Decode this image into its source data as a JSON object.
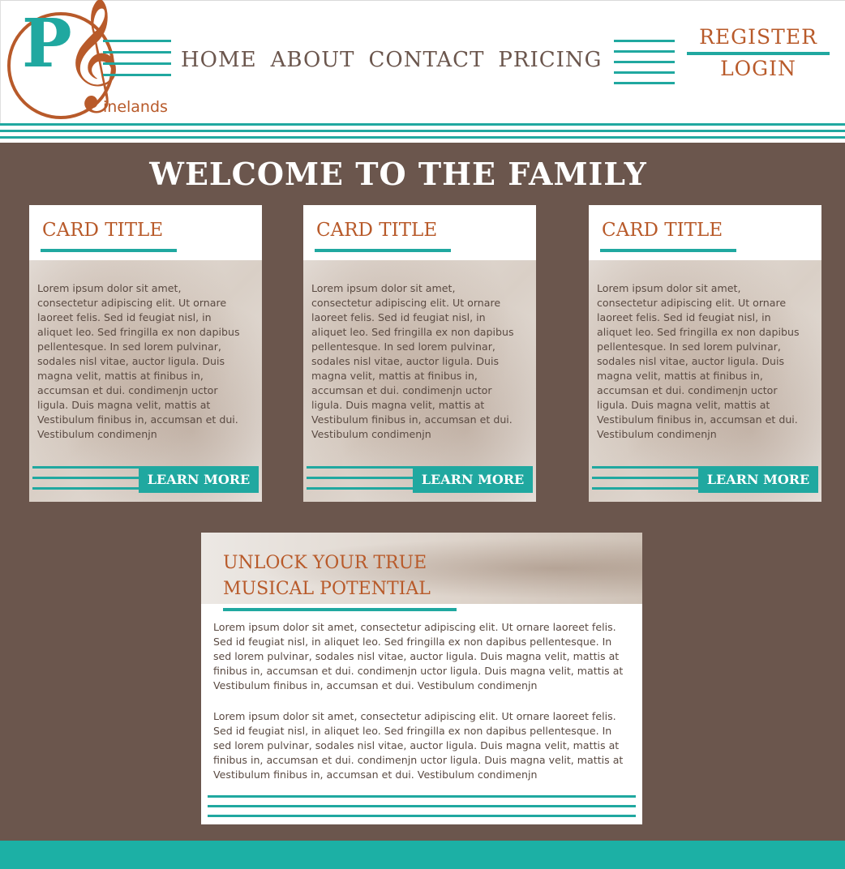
{
  "brand": {
    "logo_letter": "P",
    "logo_symbol": "𝄞",
    "logo_text": "inelands"
  },
  "nav": {
    "items": [
      {
        "label": "HOME"
      },
      {
        "label": "ABOUT"
      },
      {
        "label": "CONTACT"
      },
      {
        "label": "PRICING"
      }
    ]
  },
  "auth": {
    "register": "REGISTER",
    "login": "LOGIN"
  },
  "main": {
    "heading": "WELCOME TO THE FAMILY",
    "cards": [
      {
        "title": "CARD TITLE",
        "body": "Lorem ipsum dolor sit amet, consectetur adipiscing elit. Ut ornare laoreet felis. Sed id feugiat nisl, in aliquet leo. Sed fringilla ex non dapibus pellentesque. In sed lorem pulvinar, sodales nisl vitae, auctor ligula. Duis magna velit, mattis at finibus in, accumsan et dui. condimenjn uctor ligula. Duis magna velit, mattis at Vestibulum finibus in, accumsan et dui. Vestibulum condimenjn",
        "button": "LEARN MORE"
      },
      {
        "title": "CARD TITLE",
        "body": "Lorem ipsum dolor sit amet, consectetur adipiscing elit. Ut ornare laoreet felis. Sed id feugiat nisl, in aliquet leo. Sed fringilla ex non dapibus pellentesque. In sed lorem pulvinar, sodales nisl vitae, auctor ligula. Duis magna velit, mattis at finibus in, accumsan et dui. condimenjn uctor ligula. Duis magna velit, mattis at Vestibulum finibus in, accumsan et dui. Vestibulum condimenjn",
        "button": "LEARN MORE"
      },
      {
        "title": "CARD TITLE",
        "body": "Lorem ipsum dolor sit amet, consectetur adipiscing elit. Ut ornare laoreet felis. Sed id feugiat nisl, in aliquet leo. Sed fringilla ex non dapibus pellentesque. In sed lorem pulvinar, sodales nisl vitae, auctor ligula. Duis magna velit, mattis at finibus in, accumsan et dui. condimenjn uctor ligula. Duis magna velit, mattis at Vestibulum finibus in, accumsan et dui. Vestibulum condimenjn",
        "button": "LEARN MORE"
      }
    ],
    "panel": {
      "title": "UNLOCK YOUR TRUE MUSICAL POTENTIAL",
      "paragraph1": "Lorem ipsum dolor sit amet, consectetur adipiscing elit. Ut ornare laoreet felis. Sed id feugiat nisl, in aliquet leo. Sed fringilla ex non dapibus pellentesque. In sed lorem pulvinar, sodales nisl vitae, auctor ligula. Duis magna velit, mattis at finibus in, accumsan et dui. condimenjn uctor ligula. Duis magna velit, mattis at Vestibulum finibus in, accumsan et dui. Vestibulum condimenjn",
      "paragraph2": "Lorem ipsum dolor sit amet, consectetur adipiscing elit. Ut ornare laoreet felis. Sed id feugiat nisl, in aliquet leo. Sed fringilla ex non dapibus pellentesque. In sed lorem pulvinar, sodales nisl vitae, auctor ligula. Duis magna velit, mattis at finibus in, accumsan et dui. condimenjn uctor ligula. Duis magna velit, mattis at Vestibulum finibus in, accumsan et dui. Vestibulum condimenjn"
    }
  },
  "colors": {
    "teal": "#20a8a0",
    "rust": "#b85a2a",
    "brown": "#6b564d",
    "footer": "#1cb0a5"
  }
}
